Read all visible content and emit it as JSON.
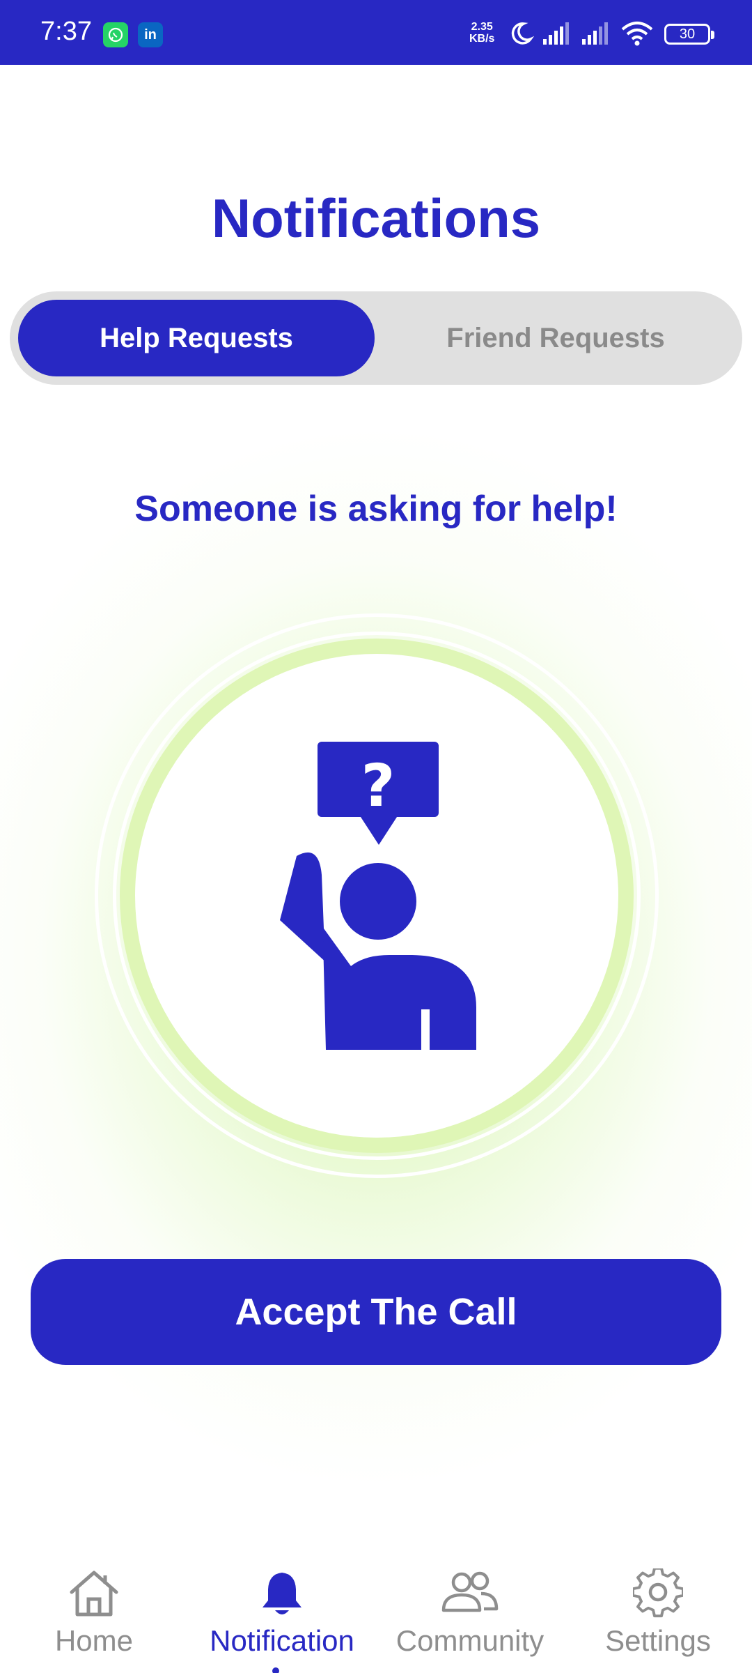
{
  "status_bar": {
    "time": "7:37",
    "app_badges": [
      "whatsapp-icon",
      "linkedin-icon"
    ],
    "linkedin_text": "in",
    "net_speed_value": "2.35",
    "net_speed_unit": "KB/s",
    "battery": "30"
  },
  "header": {
    "title": "Notifications"
  },
  "tabs": [
    {
      "label": "Help Requests",
      "active": true
    },
    {
      "label": "Friend Requests",
      "active": false
    }
  ],
  "main": {
    "heading": "Someone is asking for help!",
    "illustration": "person-raising-hand-question-icon",
    "accept_label": "Accept The Call"
  },
  "bottom_nav": {
    "items": [
      {
        "label": "Home",
        "icon": "home-icon",
        "active": false
      },
      {
        "label": "Notification",
        "icon": "bell-icon",
        "active": true
      },
      {
        "label": "Community",
        "icon": "people-icon",
        "active": false
      },
      {
        "label": "Settings",
        "icon": "gear-icon",
        "active": false
      }
    ]
  },
  "colors": {
    "brand": "#2828c3",
    "glow": "#dff6b6",
    "tab_track": "#e0e0e0",
    "inactive": "#8e8e8e"
  }
}
